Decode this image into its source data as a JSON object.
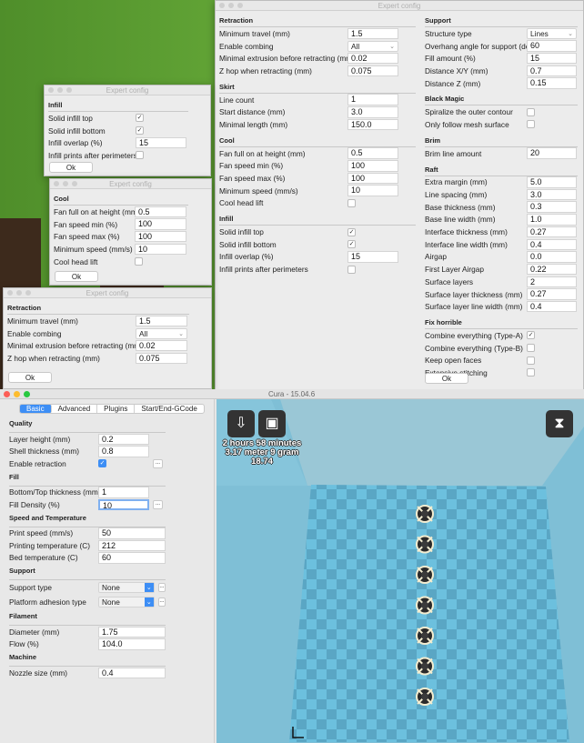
{
  "expert_main": {
    "title": "Expert config",
    "ok_label": "Ok",
    "left": [
      {
        "title": "Retraction",
        "rows": [
          {
            "label": "Minimum travel (mm)",
            "type": "text",
            "value": "1.5"
          },
          {
            "label": "Enable combing",
            "type": "select",
            "value": "All"
          },
          {
            "label": "Minimal extrusion before retracting (mm)",
            "type": "text",
            "value": "0.02"
          },
          {
            "label": "Z hop when retracting (mm)",
            "type": "text",
            "value": "0.075"
          }
        ]
      },
      {
        "title": "Skirt",
        "rows": [
          {
            "label": "Line count",
            "type": "text",
            "value": "1"
          },
          {
            "label": "Start distance (mm)",
            "type": "text",
            "value": "3.0"
          },
          {
            "label": "Minimal length (mm)",
            "type": "text",
            "value": "150.0"
          }
        ]
      },
      {
        "title": "Cool",
        "rows": [
          {
            "label": "Fan full on at height (mm)",
            "type": "text",
            "value": "0.5"
          },
          {
            "label": "Fan speed min (%)",
            "type": "text",
            "value": "100"
          },
          {
            "label": "Fan speed max (%)",
            "type": "text",
            "value": "100"
          },
          {
            "label": "Minimum speed (mm/s)",
            "type": "text",
            "value": "10"
          },
          {
            "label": "Cool head lift",
            "type": "check",
            "checked": false
          }
        ]
      },
      {
        "title": "Infill",
        "rows": [
          {
            "label": "Solid infill top",
            "type": "check",
            "checked": true
          },
          {
            "label": "Solid infill bottom",
            "type": "check",
            "checked": true
          },
          {
            "label": "Infill overlap (%)",
            "type": "text",
            "value": "15"
          },
          {
            "label": "Infill prints after perimeters",
            "type": "check",
            "checked": false
          }
        ]
      }
    ],
    "right": [
      {
        "title": "Support",
        "rows": [
          {
            "label": "Structure type",
            "type": "select",
            "value": "Lines"
          },
          {
            "label": "Overhang angle for support (deg)",
            "type": "text",
            "value": "60"
          },
          {
            "label": "Fill amount (%)",
            "type": "text",
            "value": "15"
          },
          {
            "label": "Distance X/Y (mm)",
            "type": "text",
            "value": "0.7"
          },
          {
            "label": "Distance Z (mm)",
            "type": "text",
            "value": "0.15"
          }
        ]
      },
      {
        "title": "Black Magic",
        "rows": [
          {
            "label": "Spiralize the outer contour",
            "type": "check",
            "checked": false
          },
          {
            "label": "Only follow mesh surface",
            "type": "check",
            "checked": false
          }
        ]
      },
      {
        "title": "Brim",
        "rows": [
          {
            "label": "Brim line amount",
            "type": "text",
            "value": "20"
          }
        ]
      },
      {
        "title": "Raft",
        "rows": [
          {
            "label": "Extra margin (mm)",
            "type": "text",
            "value": "5.0"
          },
          {
            "label": "Line spacing (mm)",
            "type": "text",
            "value": "3.0"
          },
          {
            "label": "Base thickness (mm)",
            "type": "text",
            "value": "0.3"
          },
          {
            "label": "Base line width (mm)",
            "type": "text",
            "value": "1.0"
          },
          {
            "label": "Interface thickness (mm)",
            "type": "text",
            "value": "0.27"
          },
          {
            "label": "Interface line width (mm)",
            "type": "text",
            "value": "0.4"
          },
          {
            "label": "Airgap",
            "type": "text",
            "value": "0.0"
          },
          {
            "label": "First Layer Airgap",
            "type": "text",
            "value": "0.22"
          },
          {
            "label": "Surface layers",
            "type": "text",
            "value": "2"
          },
          {
            "label": "Surface layer thickness (mm)",
            "type": "text",
            "value": "0.27"
          },
          {
            "label": "Surface layer line width (mm)",
            "type": "text",
            "value": "0.4"
          }
        ]
      },
      {
        "title": "Fix horrible",
        "rows": [
          {
            "label": "Combine everything (Type-A)",
            "type": "check",
            "checked": true
          },
          {
            "label": "Combine everything (Type-B)",
            "type": "check",
            "checked": false
          },
          {
            "label": "Keep open faces",
            "type": "check",
            "checked": false
          },
          {
            "label": "Extensive stitching",
            "type": "check",
            "checked": false
          }
        ]
      }
    ]
  },
  "expert_infill": {
    "title": "Expert config",
    "ok_label": "Ok",
    "left": [
      {
        "title": "Infill",
        "rows": [
          {
            "label": "Solid infill top",
            "type": "check",
            "checked": true
          },
          {
            "label": "Solid infill bottom",
            "type": "check",
            "checked": true
          },
          {
            "label": "Infill overlap (%)",
            "type": "text",
            "value": "15"
          },
          {
            "label": "Infill prints after perimeters",
            "type": "check",
            "checked": false
          }
        ]
      }
    ]
  },
  "expert_cool": {
    "title": "Expert config",
    "ok_label": "Ok",
    "left": [
      {
        "title": "Cool",
        "rows": [
          {
            "label": "Fan full on at height (mm)",
            "type": "text",
            "value": "0.5"
          },
          {
            "label": "Fan speed min (%)",
            "type": "text",
            "value": "100"
          },
          {
            "label": "Fan speed max (%)",
            "type": "text",
            "value": "100"
          },
          {
            "label": "Minimum speed (mm/s)",
            "type": "text",
            "value": "10"
          },
          {
            "label": "Cool head lift",
            "type": "check",
            "checked": false
          }
        ]
      }
    ]
  },
  "expert_retraction": {
    "title": "Expert config",
    "ok_label": "Ok",
    "left": [
      {
        "title": "Retraction",
        "rows": [
          {
            "label": "Minimum travel (mm)",
            "type": "text",
            "value": "1.5"
          },
          {
            "label": "Enable combing",
            "type": "select",
            "value": "All"
          },
          {
            "label": "Minimal extrusion before retracting (mm)",
            "type": "text",
            "value": "0.02"
          },
          {
            "label": "Z hop when retracting (mm)",
            "type": "text",
            "value": "0.075"
          }
        ]
      }
    ]
  },
  "cura": {
    "title": "Cura - 15.04.6",
    "tabs": [
      "Basic",
      "Advanced",
      "Plugins",
      "Start/End-GCode"
    ],
    "more_label": "...",
    "sections": [
      {
        "title": "Quality",
        "rows": [
          {
            "label": "Layer height (mm)",
            "type": "text",
            "value": "0.2"
          },
          {
            "label": "Shell thickness (mm)",
            "type": "text",
            "value": "0.8"
          },
          {
            "label": "Enable retraction",
            "type": "check",
            "checked": true,
            "more": true
          }
        ]
      },
      {
        "title": "Fill",
        "rows": [
          {
            "label": "Bottom/Top thickness (mm)",
            "type": "text",
            "value": "1"
          },
          {
            "label": "Fill Density (%)",
            "type": "text",
            "value": "10",
            "more": true,
            "focused": true
          }
        ]
      },
      {
        "title": "Speed and Temperature",
        "rows": [
          {
            "label": "Print speed (mm/s)",
            "type": "text",
            "value": "50"
          },
          {
            "label": "Printing temperature (C)",
            "type": "text",
            "value": "212"
          },
          {
            "label": "Bed temperature (C)",
            "type": "text",
            "value": "60"
          }
        ]
      },
      {
        "title": "Support",
        "rows": [
          {
            "label": "Support type",
            "type": "select",
            "value": "None",
            "more": true
          },
          {
            "label": "Platform adhesion type",
            "type": "select",
            "value": "None",
            "more": true
          }
        ]
      },
      {
        "title": "Filament",
        "rows": [
          {
            "label": "Diameter (mm)",
            "type": "text",
            "value": "1.75"
          },
          {
            "label": "Flow (%)",
            "type": "text",
            "value": "104.0"
          }
        ]
      },
      {
        "title": "Machine",
        "rows": [
          {
            "label": "Nozzle size (mm)",
            "type": "text",
            "value": "0.4"
          }
        ]
      }
    ],
    "viewport": {
      "print_time": "2 hours 58 minutes",
      "material": "3.17 meter 9 gram",
      "cost": "18.74",
      "object_count": 7,
      "bg_color": "#7fbfd6",
      "checker_light": "#6cc0de",
      "checker_dark": "#5aa6c4"
    }
  }
}
